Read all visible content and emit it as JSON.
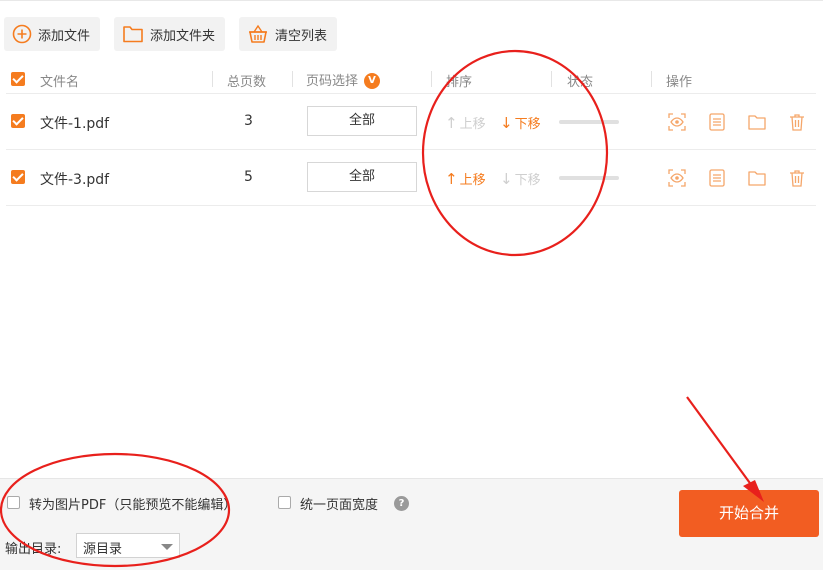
{
  "toolbar": {
    "add_file": "添加文件",
    "add_folder": "添加文件夹",
    "clear_list": "清空列表"
  },
  "table": {
    "headers": {
      "file_name": "文件名",
      "total_pages": "总页数",
      "page_select": "页码选择",
      "page_select_badge": "V",
      "sort": "排序",
      "status": "状态",
      "actions": "操作"
    },
    "rows": [
      {
        "name": "文件-1.pdf",
        "pages": "3",
        "range": "全部",
        "move_up": "上移",
        "move_down": "下移",
        "up_enabled": false,
        "down_enabled": true,
        "checked": true
      },
      {
        "name": "文件-3.pdf",
        "pages": "5",
        "range": "全部",
        "move_up": "上移",
        "move_down": "下移",
        "up_enabled": true,
        "down_enabled": false,
        "checked": true
      }
    ]
  },
  "footer": {
    "image_pdf_label": "转为图片PDF（只能预览不能编辑）",
    "uniform_width_label": "统一页面宽度",
    "help": "?",
    "output_dir_label": "输出目录:",
    "output_dir_value": "源目录",
    "start_button": "开始合并"
  },
  "colors": {
    "accent": "#f57c1f",
    "start_button": "#f25d22",
    "annotation": "#e8201c"
  }
}
